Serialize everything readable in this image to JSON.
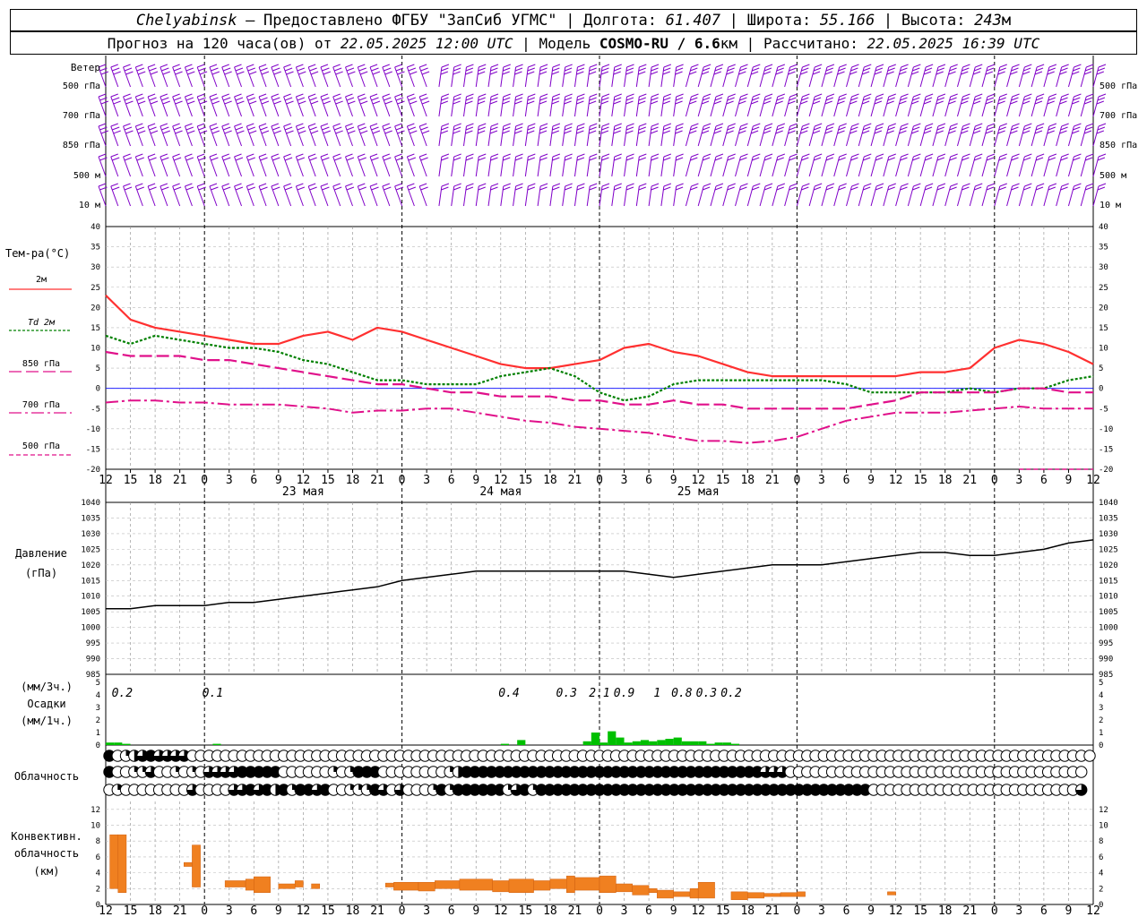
{
  "header": {
    "city": "Chelyabinsk",
    "dash": "—",
    "provided_by": "Предоставлено ФГБУ \"ЗапСиб УГМС\"",
    "sep": "|",
    "lon_label": "Долгота:",
    "lon_value": "61.407",
    "lat_label": "Широта:",
    "lat_value": "55.166",
    "alt_label": "Высота:",
    "alt_value": "243",
    "alt_unit": "м",
    "forecast_label": "Прогноз на 120 часа(ов) от",
    "forecast_time": "22.05.2025 12:00 UTC",
    "model_label": "Модель",
    "model_name": "COSMO-RU / 6.6",
    "model_unit": "км",
    "calc_label": "Рассчитано:",
    "calc_time": "22.05.2025 16:39 UTC"
  },
  "labels": {
    "wind": "Ветер",
    "wind_levels": [
      "500 гПа",
      "700 гПа",
      "850 гПа",
      "500  м",
      "10  м"
    ],
    "temp_title": "Тем-ра(°C)",
    "temp_legend": [
      "2м",
      "Td  2м",
      "850 гПа",
      "700 гПа",
      "500 гПа"
    ],
    "pressure_title": "Давление",
    "pressure_unit": "(гПа)",
    "precip_3h": "(мм/3ч.)",
    "precip_title": "Осадки",
    "precip_1h": "(мм/1ч.)",
    "cloud_title": "Облачность",
    "conv_title": "Конвективн.",
    "conv_title2": "облачность",
    "conv_unit": "(км)"
  },
  "colors": {
    "t2m": "#ff3030",
    "td2m": "#008000",
    "t850": "#e0108a",
    "t700": "#e0108a",
    "t500": "#e0108a",
    "zero": "#0000ff",
    "wind": "#8000c8",
    "precip": "#00c000",
    "conv": "#f08020"
  },
  "chart_data": [
    {
      "type": "line",
      "name_key": "wind",
      "wind_levels": [
        "500 гПа",
        "700 гПа",
        "850 гПа",
        "500 м",
        "10 м"
      ]
    },
    {
      "type": "line",
      "title": "Тем-ра(°C)",
      "x_hours": [
        0,
        3,
        6,
        9,
        12,
        15,
        18,
        21,
        24,
        27,
        30,
        33,
        36,
        39,
        42,
        45,
        48,
        51,
        54,
        57,
        60,
        63,
        66,
        69,
        72,
        75,
        78,
        81,
        84,
        87,
        90,
        93,
        96,
        99,
        102,
        105,
        108,
        111,
        114,
        117,
        120
      ],
      "x_tick_labels": [
        "12",
        "15",
        "18",
        "21",
        "0",
        "3",
        "6",
        "9",
        "12",
        "15",
        "18",
        "21",
        "0",
        "3",
        "6",
        "9",
        "12",
        "15",
        "18",
        "21",
        "0",
        "3",
        "6",
        "9",
        "12",
        "15",
        "18",
        "21",
        "0",
        "3",
        "6",
        "9",
        "12",
        "15",
        "18",
        "21",
        "0",
        "3",
        "6",
        "9",
        "12",
        "15",
        "18"
      ],
      "day_labels": [
        "23 мая",
        "24 мая",
        "25 мая"
      ],
      "ylim": [
        -20,
        40
      ],
      "yticks": [
        -20,
        -15,
        -10,
        -5,
        0,
        5,
        10,
        15,
        20,
        25,
        30,
        35,
        40
      ],
      "series": [
        {
          "name": "2м",
          "values": [
            23,
            17,
            15,
            14,
            13,
            12,
            11,
            11,
            13,
            14,
            12,
            15,
            14,
            12,
            10,
            8,
            6,
            5,
            5,
            6,
            7,
            10,
            11,
            9,
            8,
            6,
            4,
            3,
            3,
            3,
            3,
            3,
            3,
            4,
            4,
            5,
            10,
            12,
            11,
            9,
            6
          ]
        },
        {
          "name": "Td  2м",
          "values": [
            13,
            11,
            13,
            12,
            11,
            10,
            10,
            9,
            7,
            6,
            4,
            2,
            2,
            1,
            1,
            1,
            3,
            4,
            5,
            3,
            -1,
            -3,
            -2,
            1,
            2,
            2,
            2,
            2,
            2,
            2,
            1,
            -1,
            -1,
            -1,
            -1,
            0,
            -1,
            0,
            0,
            2,
            3
          ]
        },
        {
          "name": "850 гПа",
          "values": [
            9,
            8,
            8,
            8,
            7,
            7,
            6,
            5,
            4,
            3,
            2,
            1,
            1,
            0,
            -1,
            -1,
            -2,
            -2,
            -2,
            -3,
            -3,
            -4,
            -4,
            -3,
            -4,
            -4,
            -5,
            -5,
            -5,
            -5,
            -5,
            -4,
            -3,
            -1,
            -1,
            -1,
            -1,
            0,
            0,
            -1,
            -1
          ]
        },
        {
          "name": "700 гПа",
          "values": [
            -3.5,
            -3,
            -3,
            -3.5,
            -3.5,
            -4,
            -4,
            -4,
            -4.5,
            -5,
            -6,
            -5.5,
            -5.5,
            -5,
            -5,
            -6,
            -7,
            -8,
            -8.5,
            -9.5,
            -10,
            -10.5,
            -11,
            -12,
            -13,
            -13,
            -13.5,
            -13,
            -12,
            -10,
            -8,
            -7,
            -6,
            -6,
            -6,
            -5.5,
            -5,
            -4.5,
            -5,
            -5,
            -5
          ]
        },
        {
          "name": "500 гПа",
          "values": [
            null,
            null,
            null,
            null,
            null,
            null,
            null,
            null,
            null,
            null,
            null,
            null,
            null,
            null,
            null,
            null,
            null,
            null,
            null,
            null,
            null,
            null,
            null,
            null,
            null,
            null,
            null,
            null,
            null,
            null,
            null,
            null,
            null,
            null,
            null,
            null,
            null,
            -20,
            -20,
            -20,
            -20
          ]
        }
      ]
    },
    {
      "type": "line",
      "title": "Давление",
      "ylabel": "(гПа)",
      "ylim": [
        985,
        1040
      ],
      "yticks": [
        985,
        990,
        995,
        1000,
        1005,
        1010,
        1015,
        1020,
        1025,
        1030,
        1035,
        1040
      ],
      "x_hours": [
        0,
        3,
        6,
        9,
        12,
        15,
        18,
        21,
        24,
        27,
        30,
        33,
        36,
        39,
        42,
        45,
        48,
        51,
        54,
        57,
        60,
        63,
        66,
        69,
        72,
        75,
        78,
        81,
        84,
        87,
        90,
        93,
        96,
        99,
        102,
        105,
        108,
        111,
        114,
        117,
        120
      ],
      "values": [
        1006,
        1006,
        1007,
        1007,
        1007,
        1008,
        1008,
        1009,
        1010,
        1011,
        1012,
        1013,
        1015,
        1016,
        1017,
        1018,
        1018,
        1018,
        1018,
        1018,
        1018,
        1018,
        1017,
        1016,
        1017,
        1018,
        1019,
        1020,
        1020,
        1020,
        1021,
        1022,
        1023,
        1024,
        1024,
        1023,
        1023,
        1024,
        1025,
        1027,
        1028
      ]
    },
    {
      "type": "bar",
      "title": "Осадки",
      "ylabel": "(мм/1ч.)",
      "ylim": [
        0,
        5
      ],
      "yticks": [
        0,
        1,
        2,
        3,
        4,
        5
      ],
      "precip_3h_labels": [
        {
          "hour": 2,
          "text": "0.2"
        },
        {
          "hour": 13,
          "text": "0.1"
        },
        {
          "hour": 49,
          "text": "0.4"
        },
        {
          "hour": 56,
          "text": "0.3"
        },
        {
          "hour": 60,
          "text": "2.1"
        },
        {
          "hour": 63,
          "text": "0.9"
        },
        {
          "hour": 67,
          "text": "1"
        },
        {
          "hour": 70,
          "text": "0.8"
        },
        {
          "hour": 73,
          "text": "0.3"
        },
        {
          "hour": 76,
          "text": "0.2"
        }
      ],
      "bars_mm_per_h": [
        {
          "hour": 0,
          "value": 0.2
        },
        {
          "hour": 1,
          "value": 0.2
        },
        {
          "hour": 2,
          "value": 0.1
        },
        {
          "hour": 13,
          "value": 0.1
        },
        {
          "hour": 48,
          "value": 0.1
        },
        {
          "hour": 50,
          "value": 0.4
        },
        {
          "hour": 58,
          "value": 0.3
        },
        {
          "hour": 59,
          "value": 1.0
        },
        {
          "hour": 60,
          "value": 0.2
        },
        {
          "hour": 61,
          "value": 1.1
        },
        {
          "hour": 62,
          "value": 0.6
        },
        {
          "hour": 63,
          "value": 0.2
        },
        {
          "hour": 64,
          "value": 0.3
        },
        {
          "hour": 65,
          "value": 0.4
        },
        {
          "hour": 66,
          "value": 0.3
        },
        {
          "hour": 67,
          "value": 0.4
        },
        {
          "hour": 68,
          "value": 0.5
        },
        {
          "hour": 69,
          "value": 0.6
        },
        {
          "hour": 70,
          "value": 0.3
        },
        {
          "hour": 71,
          "value": 0.3
        },
        {
          "hour": 72,
          "value": 0.3
        },
        {
          "hour": 73,
          "value": 0.1
        },
        {
          "hour": 74,
          "value": 0.2
        },
        {
          "hour": 75,
          "value": 0.2
        },
        {
          "hour": 76,
          "value": 0.1
        }
      ]
    },
    {
      "type": "table",
      "title": "Облачность",
      "rows": [
        "4012343333000000000000000000000000000000000000000000000000000000000000000000000000000000000000000000000000000000000000000",
        "4001130010103333444440000001014440000000012444444444444444444444444444444444444333000000000000000000000000000000000000",
        "0100000000300003343424144340011143030001414444441341444444444444444444444444444444444444444400000000000000000000000003"
      ]
    },
    {
      "type": "bar",
      "title": "Конвективн. облачность",
      "ylabel": "(км)",
      "ylim": [
        0,
        13
      ],
      "yticks": [
        0,
        2,
        4,
        6,
        8,
        10,
        12
      ],
      "segments_km": [
        {
          "h0": 0.5,
          "h1": 1.5,
          "base": 2.0,
          "top": 8.8
        },
        {
          "h0": 1.5,
          "h1": 2.5,
          "base": 1.5,
          "top": 8.8
        },
        {
          "h0": 9.5,
          "h1": 10.5,
          "base": 4.8,
          "top": 5.3
        },
        {
          "h0": 10.5,
          "h1": 11.5,
          "base": 2.2,
          "top": 7.5
        },
        {
          "h0": 14.5,
          "h1": 17,
          "base": 2.2,
          "top": 3.0
        },
        {
          "h0": 17,
          "h1": 18,
          "base": 1.8,
          "top": 3.2
        },
        {
          "h0": 18,
          "h1": 20,
          "base": 1.5,
          "top": 3.5
        },
        {
          "h0": 21,
          "h1": 23,
          "base": 2.0,
          "top": 2.6
        },
        {
          "h0": 23,
          "h1": 24,
          "base": 2.2,
          "top": 3.0
        },
        {
          "h0": 25,
          "h1": 26,
          "base": 2.0,
          "top": 2.6
        },
        {
          "h0": 34,
          "h1": 35,
          "base": 2.2,
          "top": 2.7
        },
        {
          "h0": 35,
          "h1": 38,
          "base": 1.8,
          "top": 2.8
        },
        {
          "h0": 38,
          "h1": 40,
          "base": 1.7,
          "top": 2.8
        },
        {
          "h0": 40,
          "h1": 43,
          "base": 2.0,
          "top": 3.0
        },
        {
          "h0": 43,
          "h1": 47,
          "base": 1.8,
          "top": 3.2
        },
        {
          "h0": 47,
          "h1": 49,
          "base": 1.6,
          "top": 3.0
        },
        {
          "h0": 49,
          "h1": 52,
          "base": 1.5,
          "top": 3.2
        },
        {
          "h0": 52,
          "h1": 54,
          "base": 1.8,
          "top": 3.0
        },
        {
          "h0": 54,
          "h1": 56,
          "base": 2.0,
          "top": 3.2
        },
        {
          "h0": 56,
          "h1": 57,
          "base": 1.5,
          "top": 3.6
        },
        {
          "h0": 57,
          "h1": 60,
          "base": 1.8,
          "top": 3.4
        },
        {
          "h0": 60,
          "h1": 62,
          "base": 1.5,
          "top": 3.6
        },
        {
          "h0": 62,
          "h1": 64,
          "base": 1.6,
          "top": 2.6
        },
        {
          "h0": 64,
          "h1": 66,
          "base": 1.2,
          "top": 2.4
        },
        {
          "h0": 66,
          "h1": 67,
          "base": 1.5,
          "top": 2.0
        },
        {
          "h0": 67,
          "h1": 69,
          "base": 0.8,
          "top": 1.8
        },
        {
          "h0": 69,
          "h1": 71,
          "base": 1.0,
          "top": 1.6
        },
        {
          "h0": 71,
          "h1": 72,
          "base": 0.8,
          "top": 2.0
        },
        {
          "h0": 72,
          "h1": 74,
          "base": 0.8,
          "top": 2.8
        },
        {
          "h0": 76,
          "h1": 78,
          "base": 0.6,
          "top": 1.6
        },
        {
          "h0": 78,
          "h1": 80,
          "base": 0.8,
          "top": 1.5
        },
        {
          "h0": 80,
          "h1": 82,
          "base": 1.0,
          "top": 1.4
        },
        {
          "h0": 82,
          "h1": 84,
          "base": 1.0,
          "top": 1.5
        },
        {
          "h0": 84,
          "h1": 85,
          "base": 1.0,
          "top": 1.6
        },
        {
          "h0": 95,
          "h1": 96,
          "base": 1.2,
          "top": 1.6
        }
      ]
    }
  ]
}
